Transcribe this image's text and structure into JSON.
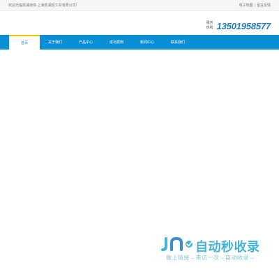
{
  "topbar": {
    "welcome": "欢迎光临凯澜液体-上海凯澜轻工贸有限公司!",
    "links": [
      "电子地图",
      "留言反馈"
    ]
  },
  "header": {
    "hotline_label": "服务热线",
    "hotline_number": "13501958577"
  },
  "nav": {
    "items": [
      "首页",
      "关于我们",
      "产品中心",
      "成功案例",
      "新闻中心",
      "联系我们"
    ],
    "active_index": 0
  },
  "watermark": {
    "title": "自动秒收录",
    "slogan": "做上链接→来访一次→自动收录→"
  },
  "colors": {
    "nav_bg": "#0a8fd5",
    "nav_active_accent": "#f2c200",
    "phone": "#1f7bc6",
    "watermark": "#42b4d9"
  }
}
